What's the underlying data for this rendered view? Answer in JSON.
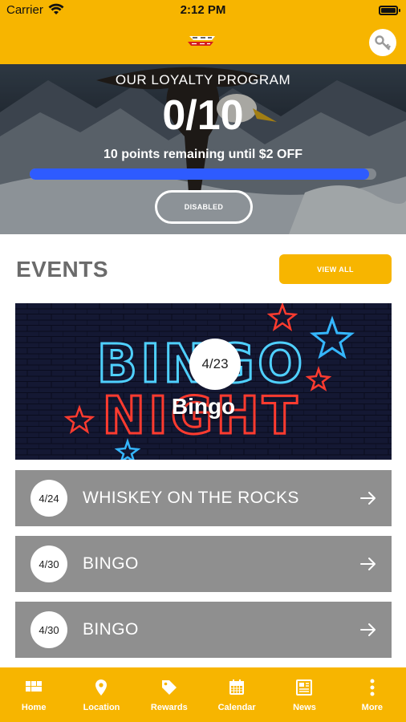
{
  "status": {
    "carrier": "Carrier",
    "time": "2:12 PM"
  },
  "colors": {
    "brand": "#f7b500",
    "progress": "#2e5bff",
    "row": "#8f8f8f"
  },
  "icons": {
    "header_right": "key-icon",
    "logo": "brand-logo"
  },
  "loyalty": {
    "title": "OUR LOYALTY PROGRAM",
    "points": "0/10",
    "remaining": "10 points remaining until $2 OFF",
    "progress_fraction": 0.98,
    "button_label": "DISABLED"
  },
  "events": {
    "title": "EVENTS",
    "view_all_label": "VIEW ALL",
    "featured": {
      "date": "4/23",
      "name": "Bingo",
      "image_text": [
        "BINGO",
        "NIGHT"
      ]
    },
    "list": [
      {
        "date": "4/24",
        "name": "WHISKEY ON THE ROCKS"
      },
      {
        "date": "4/30",
        "name": "BINGO"
      },
      {
        "date": "4/30",
        "name": "BINGO"
      }
    ]
  },
  "tabs": [
    {
      "label": "Home",
      "icon": "grid-icon"
    },
    {
      "label": "Location",
      "icon": "map-pin-icon"
    },
    {
      "label": "Rewards",
      "icon": "tag-icon"
    },
    {
      "label": "Calendar",
      "icon": "calendar-icon"
    },
    {
      "label": "News",
      "icon": "newspaper-icon"
    },
    {
      "label": "More",
      "icon": "more-vertical-icon"
    }
  ]
}
